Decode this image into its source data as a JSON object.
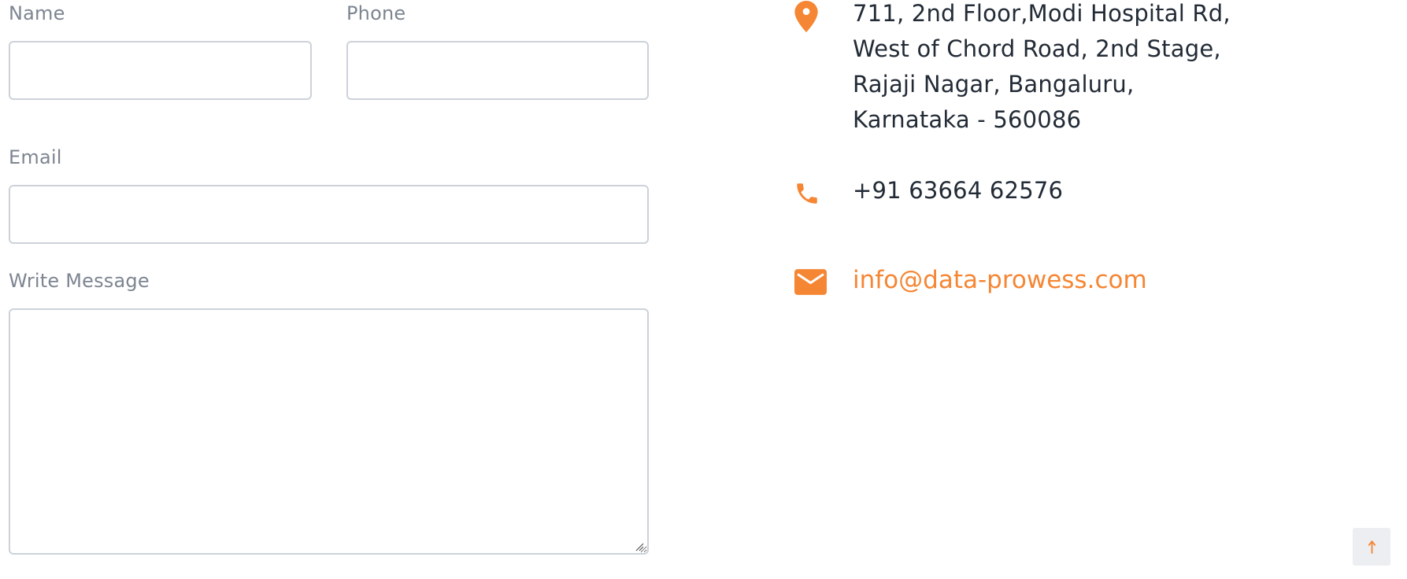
{
  "form": {
    "name_label": "Name",
    "name_value": "",
    "phone_label": "Phone",
    "phone_value": "",
    "email_label": "Email",
    "email_value": "",
    "message_label": "Write Message",
    "message_value": ""
  },
  "contact": {
    "address_lines": [
      "711, 2nd Floor,Modi Hospital Rd,",
      "West of Chord Road, 2nd Stage,",
      "Rajaji Nagar, Bangaluru,",
      "Karnataka - 560086"
    ],
    "phone": "+91 63664 62576",
    "email": "info@data-prowess.com",
    "address_icon": "map-pin-icon",
    "phone_icon": "phone-icon",
    "email_icon": "envelope-icon"
  },
  "scroll_top": {
    "icon": "arrow-up-icon",
    "glyph": "↑"
  },
  "colors": {
    "accent": "#f58634",
    "label": "#7d8591",
    "text": "#222b36",
    "field_border": "#cdd2da"
  }
}
